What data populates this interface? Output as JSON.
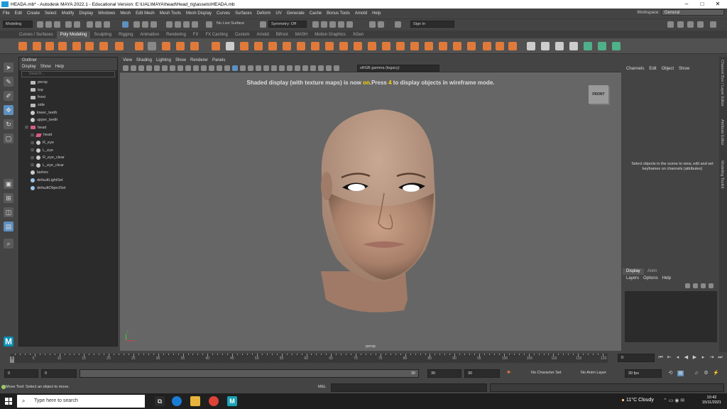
{
  "window": {
    "title": "HEADA.mb* - Autodesk MAYA 2022.1 - Educational Version: E:\\UAL\\MAYA\\head\\Head_rig\\assets\\HEADA.mb",
    "minimize": "–",
    "maximize": "□",
    "close": "✕"
  },
  "menubar": [
    "File",
    "Edit",
    "Create",
    "Select",
    "Modify",
    "Display",
    "Windows",
    "Mesh",
    "Edit Mesh",
    "Mesh Tools",
    "Mesh Display",
    "Curves",
    "Surfaces",
    "Deform",
    "UV",
    "Generate",
    "Cache",
    "Bonus Tools",
    "Arnold",
    "Help"
  ],
  "workspace": {
    "label": "Workspace:",
    "value": "General"
  },
  "statusline": {
    "mode": "Modeling",
    "live_surface": "No Live Surface",
    "symmetry": "Symmetry: Off",
    "sign_in": "Sign In"
  },
  "shelf_tabs": [
    "Curves / Surfaces",
    "Poly Modeling",
    "Sculpting",
    "Rigging",
    "Animation",
    "Rendering",
    "FX",
    "FX Caching",
    "Custom",
    "Arnold",
    "Bifrost",
    "MASH",
    "Motion Graphics",
    "XGen"
  ],
  "shelf_active": "Poly Modeling",
  "outliner": {
    "title": "Outliner",
    "menu": [
      "Display",
      "Show",
      "Help"
    ],
    "search_placeholder": "Search...",
    "items": [
      {
        "label": "persp",
        "icon": "camera"
      },
      {
        "label": "top",
        "icon": "camera"
      },
      {
        "label": "front",
        "icon": "camera"
      },
      {
        "label": "side",
        "icon": "camera"
      },
      {
        "label": "lower_teeth",
        "icon": "joint"
      },
      {
        "label": "upper_teeth",
        "icon": "joint"
      },
      {
        "label": "head",
        "icon": "group"
      },
      {
        "label": "head",
        "icon": "mesh"
      },
      {
        "label": "R_eye",
        "icon": "joint"
      },
      {
        "label": "L_eye",
        "icon": "joint"
      },
      {
        "label": "R_eye_clear",
        "icon": "joint"
      },
      {
        "label": "L_eye_clear",
        "icon": "joint"
      },
      {
        "label": "lashes",
        "icon": "joint"
      },
      {
        "label": "defaultLightSet",
        "icon": "set"
      },
      {
        "label": "defaultObjectSet",
        "icon": "set"
      }
    ]
  },
  "viewport": {
    "menu": [
      "View",
      "Shading",
      "Lighting",
      "Show",
      "Renderer",
      "Panels"
    ],
    "color_space": "sRGB gamma (legacy)",
    "hud_before": "Shaded display (with texture maps) is now ",
    "hud_on": "on",
    "hud_mid": ".Press ",
    "hud_key": "4",
    "hud_after": " to display objects in wireframe mode.",
    "viewcube": "FRONT",
    "camera": "persp",
    "axis_x": "x",
    "axis_y": "y"
  },
  "channelbox": {
    "menu": [
      "Channels",
      "Edit",
      "Object",
      "Show"
    ],
    "message": "Select objects in the scene to view, edit and set keyframes on channels (attributes)"
  },
  "side_tabs": [
    "Channel Box / Layer Editor",
    "Attribute Editor",
    "Modeling Toolkit"
  ],
  "layer_panel": {
    "tabs": [
      "Display",
      "Anim"
    ],
    "menu": [
      "Layers",
      "Options",
      "Help"
    ]
  },
  "timeline": {
    "ticks": [
      "5",
      "10",
      "15",
      "20",
      "25",
      "30",
      "35",
      "40",
      "45",
      "50",
      "55",
      "60",
      "65",
      "70",
      "75",
      "80",
      "85",
      "90",
      "95",
      "100",
      "105",
      "110",
      "115",
      "120"
    ],
    "current_frame": "0",
    "end": "0"
  },
  "range": {
    "start": "0",
    "anim_start": "0",
    "range_end": "30",
    "playback_end": "30",
    "anim_end": "30",
    "character_set": "No Character Set",
    "anim_layer": "No Anim Layer",
    "fps": "30 fps"
  },
  "cmdline": {
    "help": "Move Tool: Select an object to move.",
    "lang": "MEL"
  },
  "taskbar": {
    "search": "Type here to search",
    "weather": "11°C  Cloudy",
    "time": "10:42",
    "date": "15/11/2021"
  }
}
